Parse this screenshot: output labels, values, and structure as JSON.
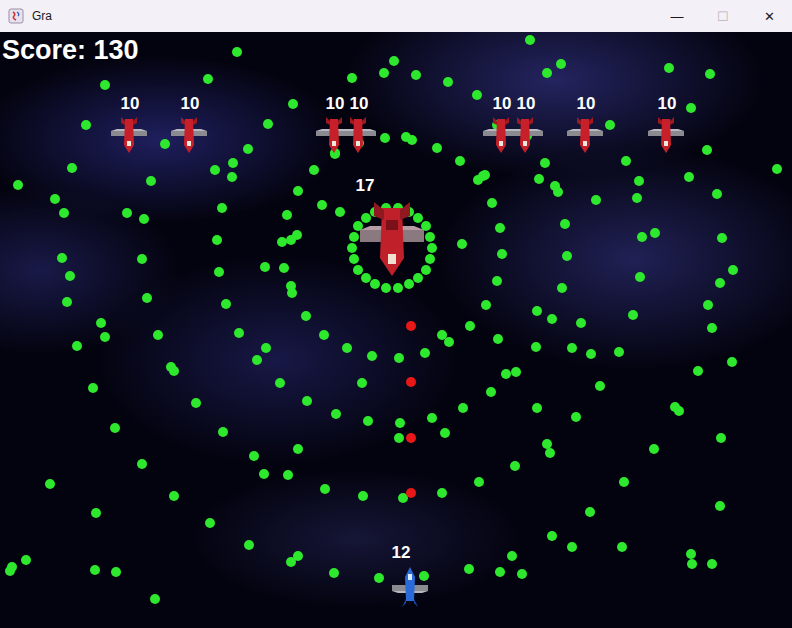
{
  "window": {
    "title": "Gra",
    "controls": [
      "—",
      "☐",
      "✕"
    ]
  },
  "hud": {
    "score": "Score: 130"
  },
  "enemies": [
    {
      "hp": "10"
    },
    {
      "hp": "10"
    },
    {
      "hp": "10"
    },
    {
      "hp": "10"
    },
    {
      "hp": "10"
    },
    {
      "hp": "10"
    },
    {
      "hp": "10"
    },
    {
      "hp": "10"
    }
  ],
  "boss": {
    "hp": "17"
  },
  "player": {
    "hp": "12"
  }
}
